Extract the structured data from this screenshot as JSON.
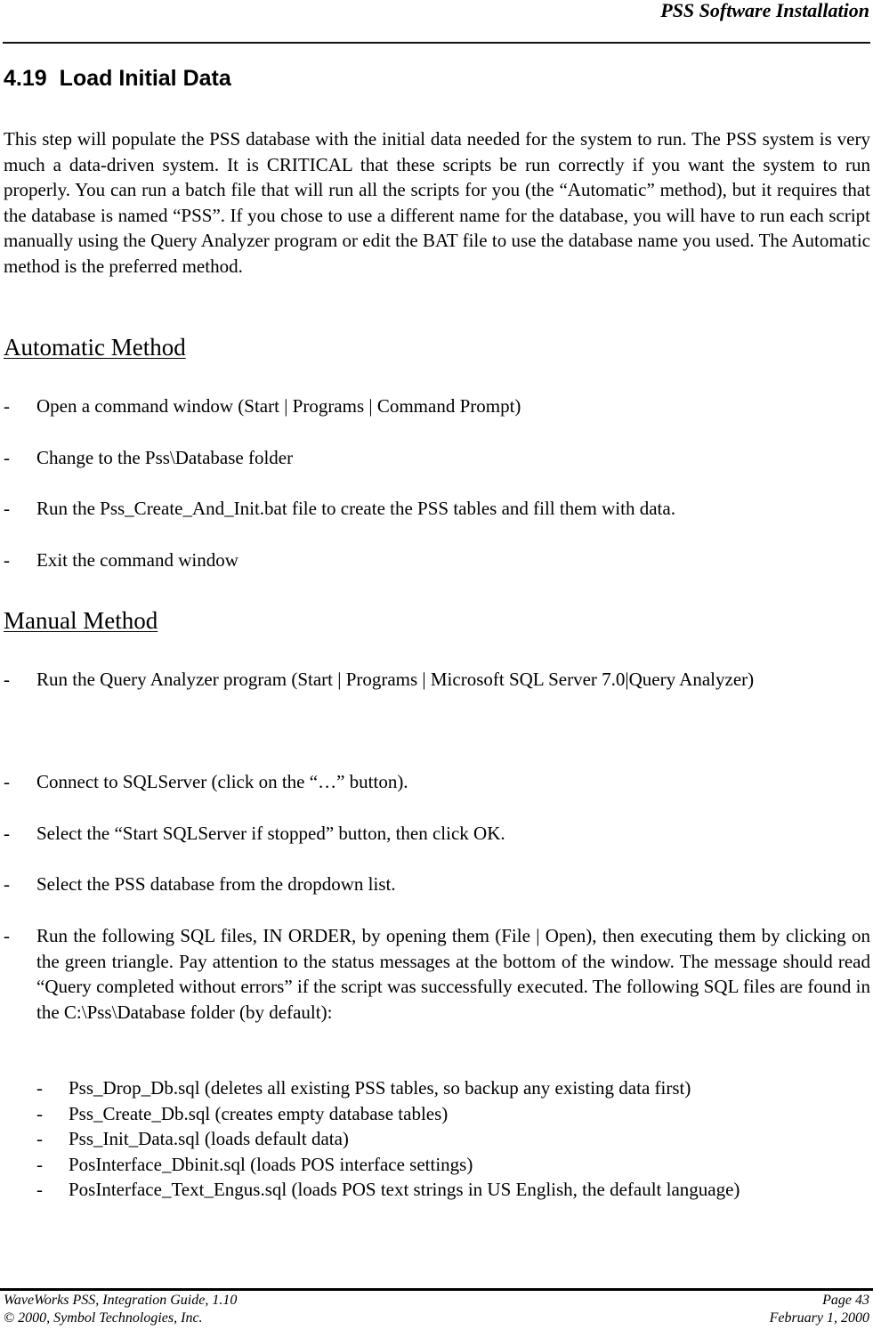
{
  "header": {
    "running_title": "PSS Software Installation"
  },
  "section": {
    "number": "4.19",
    "title": "Load Initial Data",
    "intro": "This step will populate the PSS database with the initial data needed for the system to run.  The PSS system is very much a data-driven system.  It is CRITICAL that these scripts be run correctly if you want the system to run properly.  You can run a batch file that will run all the scripts for you (the “Automatic” method), but it requires that the database is named “PSS”.  If you chose to use a different name for the database, you will have to run each script manually using the Query Analyzer program or edit the BAT file to use the database name you used.  The Automatic method is the preferred method."
  },
  "automatic": {
    "heading": "Automatic Method",
    "steps": [
      "Open a command window (Start | Programs | Command Prompt)",
      "Change to the Pss\\Database folder",
      "Run the Pss_Create_And_Init.bat file to create the PSS tables and fill them with data.",
      "Exit the command window"
    ]
  },
  "manual": {
    "heading": "Manual Method",
    "steps": [
      "Run the Query Analyzer program (Start | Programs | Microsoft SQL Server 7.0|Query Analyzer)",
      "Connect to SQLServer (click on  the “…” button).",
      "Select the “Start SQLServer if stopped”  button, then click OK.",
      "Select the PSS database from the dropdown list.",
      "Run the following SQL files, IN ORDER, by opening them (File | Open), then executing them by clicking on the green triangle.  Pay attention to the status messages at the bottom of the window.  The message should read “Query completed without errors” if the script was successfully executed.  The following SQL files are found in the C:\\Pss\\Database folder (by default):"
    ],
    "sql_files": [
      "Pss_Drop_Db.sql (deletes all existing PSS tables, so backup any existing data first)",
      "Pss_Create_Db.sql (creates empty database tables)",
      "Pss_Init_Data.sql (loads default data)",
      "PosInterface_Dbinit.sql (loads POS interface settings)",
      "PosInterface_Text_Engus.sql (loads POS text strings in US English, the default language)"
    ]
  },
  "bullet": "-",
  "footer": {
    "guide": "WaveWorks PSS, Integration Guide, 1.10",
    "copyright": "© 2000, Symbol Technologies, Inc.",
    "page": "Page 43",
    "date": "February 1, 2000"
  }
}
